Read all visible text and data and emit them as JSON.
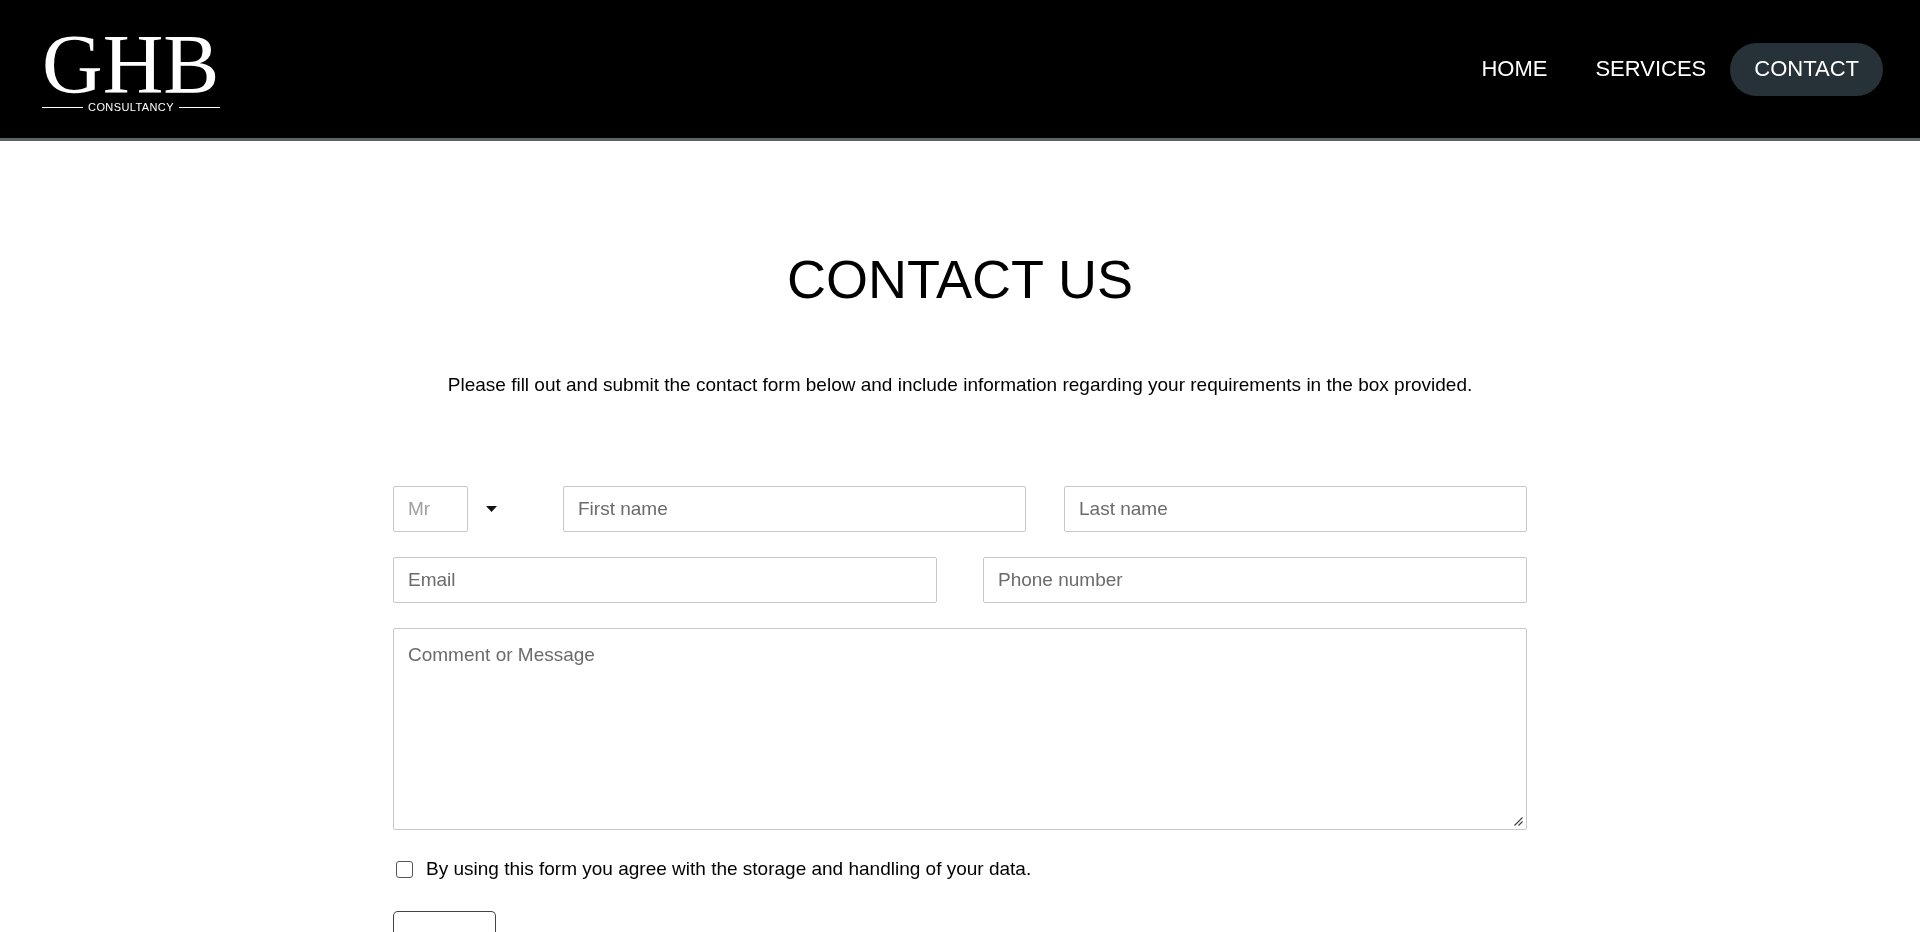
{
  "header": {
    "logo": {
      "mark": "GHB",
      "tagline": "CONSULTANCY"
    },
    "nav": [
      {
        "label": "HOME",
        "selected": false
      },
      {
        "label": "SERVICES",
        "selected": false
      },
      {
        "label": "CONTACT",
        "selected": true
      }
    ]
  },
  "page": {
    "title": "CONTACT US",
    "intro": "Please fill out and submit the contact form below and include information regarding your requirements in the box provided."
  },
  "form": {
    "rows": [
      {
        "fields": [
          {
            "kind": "select",
            "value": "Mr"
          },
          {
            "kind": "text",
            "placeholder": "First name"
          },
          {
            "kind": "text",
            "placeholder": "Last name"
          }
        ]
      },
      {
        "fields": [
          {
            "kind": "text",
            "placeholder": "Email"
          },
          {
            "kind": "text",
            "placeholder": "Phone number"
          }
        ]
      },
      {
        "fields": [
          {
            "kind": "textarea",
            "placeholder": "Comment or Message"
          }
        ]
      }
    ],
    "consent": {
      "label": "By using this form you agree with the storage and handling of your data.",
      "checked": false
    }
  }
}
